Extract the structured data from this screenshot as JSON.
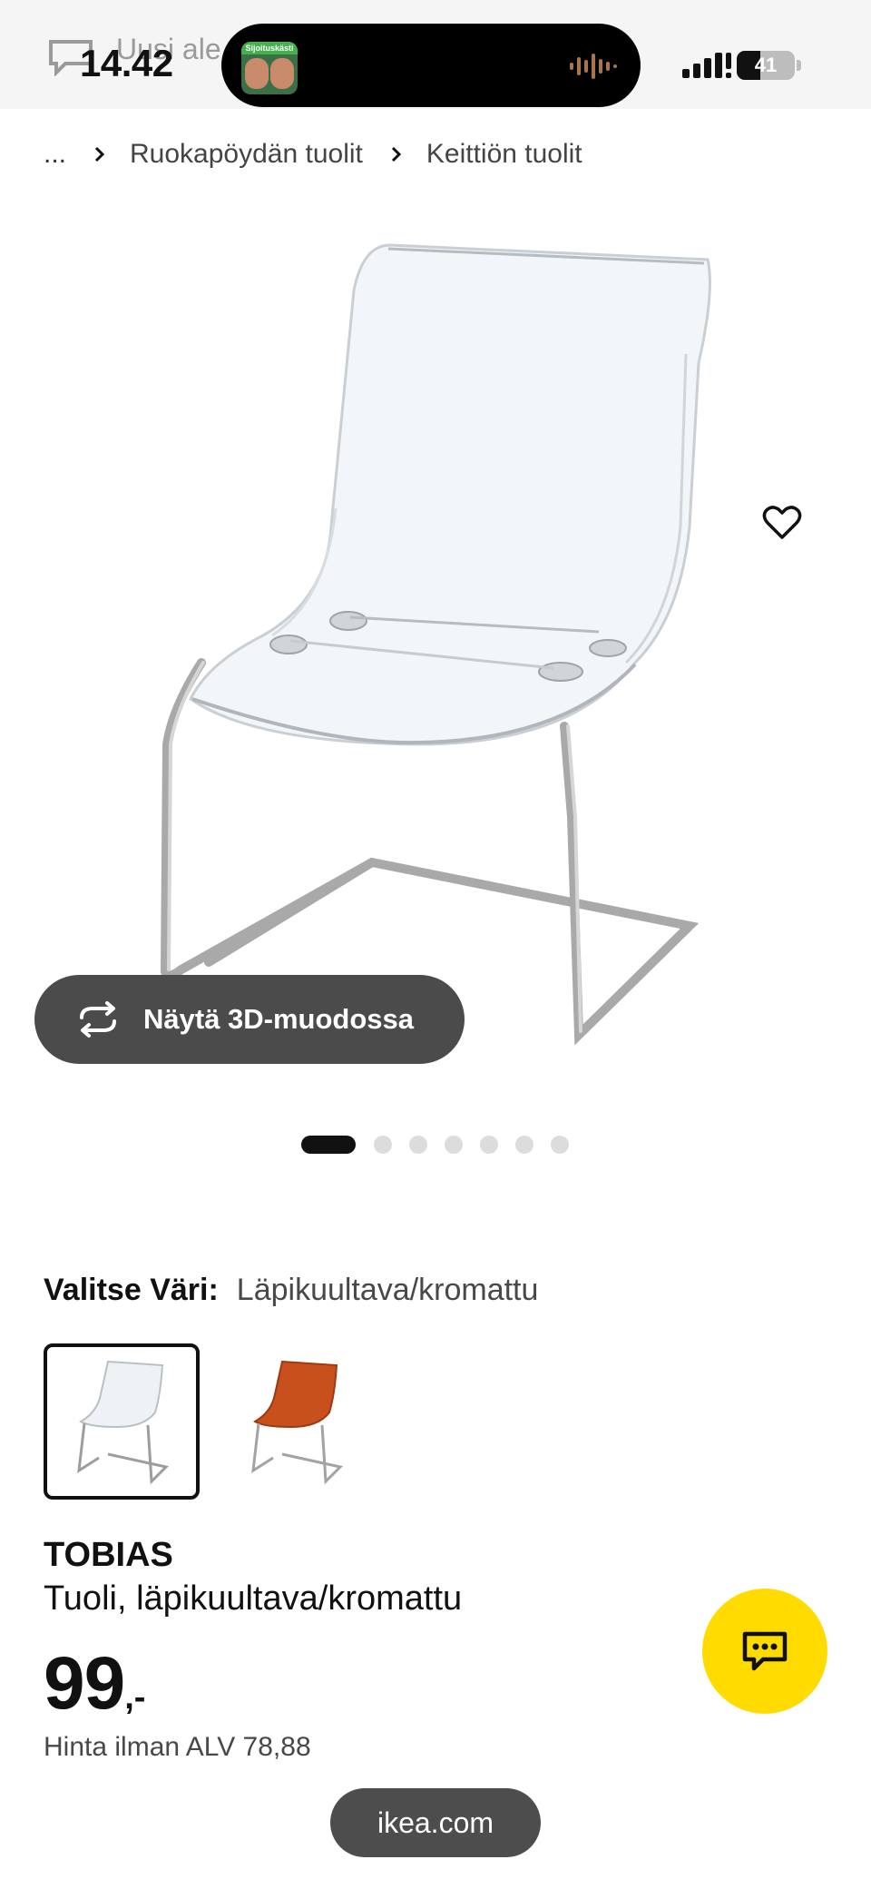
{
  "status_bar": {
    "time": "14.42",
    "battery": "41",
    "behind_text": "Uusi ale",
    "now_playing_badge": "Sijoituskästi"
  },
  "breadcrumb": {
    "ellipsis": "...",
    "items": [
      "Ruokapöydän tuolit",
      "Keittiön tuolit"
    ]
  },
  "hero": {
    "view_3d_label": "Näytä 3D-muodossa",
    "image_count": 7,
    "active_index": 0
  },
  "color_select": {
    "label": "Valitse Väri:",
    "value": "Läpikuultava/kromattu",
    "options": [
      {
        "name": "transparent-chrome",
        "color": "#e9eef2",
        "selected": true
      },
      {
        "name": "orange-chrome",
        "color": "#c8501c",
        "selected": false
      }
    ]
  },
  "product": {
    "name": "TOBIAS",
    "description": "Tuoli, läpikuultava/kromattu",
    "price_integer": "99",
    "price_suffix": ",-",
    "price_vat": "Hinta ilman ALV 78,88"
  },
  "browser": {
    "url": "ikea.com"
  },
  "colors": {
    "chat_fab": "#ffdb00",
    "button_dark": "#4b4b4b"
  }
}
